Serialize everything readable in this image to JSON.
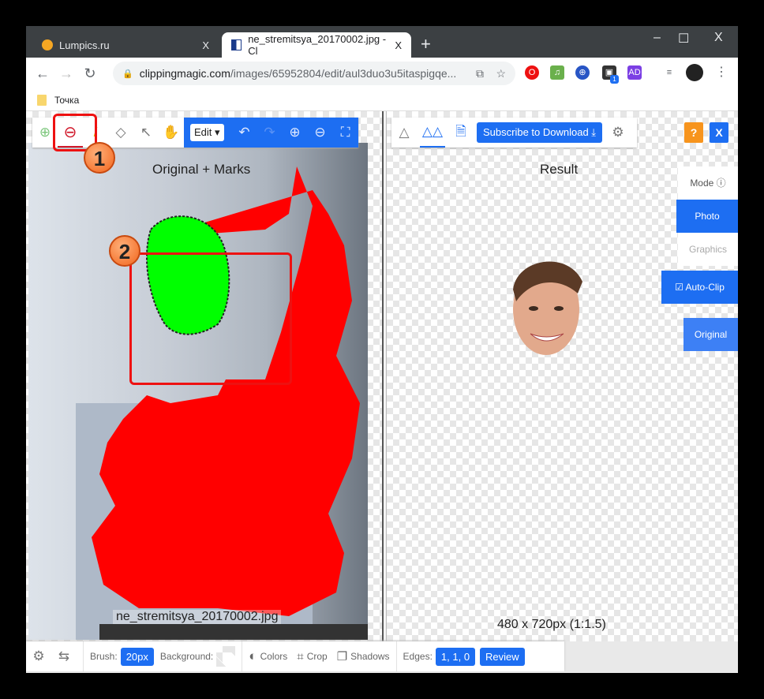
{
  "browser": {
    "tabs": [
      {
        "label": "Lumpics.ru",
        "close": "X"
      },
      {
        "label": "ne_stremitsya_20170002.jpg - Cl",
        "close": "X"
      }
    ],
    "new_tab": "+",
    "window_controls": [
      "–",
      "☐",
      "X"
    ],
    "url_host": "clippingmagic.com",
    "url_path": "/images/65952804/edit/aul3duo3u5itaspigqe...",
    "bookmark": "Точка",
    "ext_badge": "1"
  },
  "toolbar": {
    "edit_label": "Edit ▾",
    "subscribe_label": "Subscribe to Download ⤓",
    "help": "?",
    "close": "X"
  },
  "left": {
    "title": "Original + Marks",
    "filename": "ne_stremitsya_20170002.jpg"
  },
  "right": {
    "title": "Result",
    "dimensions": "480 x 720px (1:1.5)"
  },
  "side_panel": {
    "mode": "Mode ⓘ",
    "photo": "Photo",
    "graphics": "Graphics",
    "autoclip": "☑ Auto-Clip",
    "original": "Original"
  },
  "bottom": {
    "brush_label": "Brush:",
    "brush_value": "20px",
    "background_label": "Background:",
    "colors": "Colors",
    "crop": "Crop",
    "shadows": "Shadows",
    "edges_label": "Edges:",
    "edges_value": "1, 1, 0",
    "review": "Review"
  },
  "annotations": [
    "1",
    "2"
  ],
  "colors": {
    "accent": "#1d6ef2",
    "annotation": "#ee1111",
    "mark_red": "#ff0000",
    "mark_green": "#00ff00"
  }
}
